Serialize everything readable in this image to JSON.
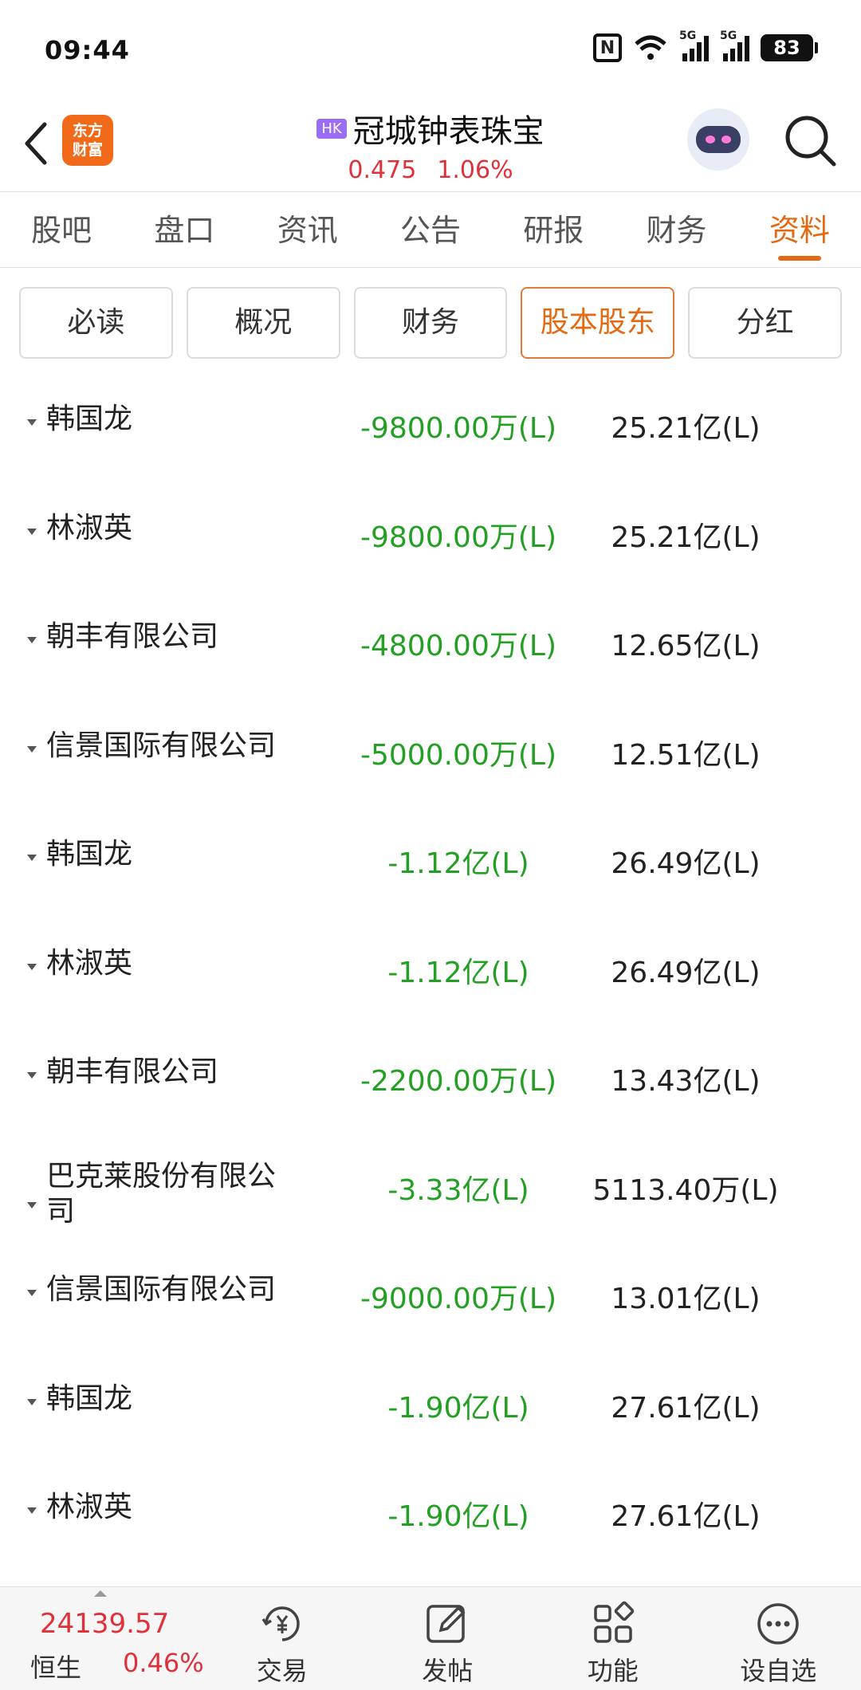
{
  "status_bar": {
    "time": "09:44",
    "signal1": "5G",
    "signal2": "5G",
    "battery": "83",
    "nfc": "N"
  },
  "header": {
    "logo_line1": "东方",
    "logo_line2": "财富",
    "market_badge": "HK",
    "stock_name": "冠城钟表珠宝",
    "price": "0.475",
    "change_pct": "1.06%"
  },
  "tabs": [
    {
      "label": "股吧",
      "active": false
    },
    {
      "label": "盘口",
      "active": false
    },
    {
      "label": "资讯",
      "active": false
    },
    {
      "label": "公告",
      "active": false
    },
    {
      "label": "研报",
      "active": false
    },
    {
      "label": "财务",
      "active": false
    },
    {
      "label": "资料",
      "active": true
    }
  ],
  "chips": [
    {
      "label": "必读",
      "active": false
    },
    {
      "label": "概况",
      "active": false
    },
    {
      "label": "财务",
      "active": false
    },
    {
      "label": "股本股东",
      "active": true
    },
    {
      "label": "分红",
      "active": false
    }
  ],
  "shareholder_changes": [
    {
      "name": "韩国龙",
      "change": "-9800.00万(L)",
      "holding": "25.21亿(L)"
    },
    {
      "name": "林淑英",
      "change": "-9800.00万(L)",
      "holding": "25.21亿(L)"
    },
    {
      "name": "朝丰有限公司",
      "change": "-4800.00万(L)",
      "holding": "12.65亿(L)"
    },
    {
      "name": "信景国际有限公司",
      "change": "-5000.00万(L)",
      "holding": "12.51亿(L)"
    },
    {
      "name": "韩国龙",
      "change": "-1.12亿(L)",
      "holding": "26.49亿(L)"
    },
    {
      "name": "林淑英",
      "change": "-1.12亿(L)",
      "holding": "26.49亿(L)"
    },
    {
      "name": "朝丰有限公司",
      "change": "-2200.00万(L)",
      "holding": "13.43亿(L)"
    },
    {
      "name": "巴克莱股份有限公司",
      "change": "-3.33亿(L)",
      "holding": "5113.40万(L)"
    },
    {
      "name": "信景国际有限公司",
      "change": "-9000.00万(L)",
      "holding": "13.01亿(L)"
    },
    {
      "name": "韩国龙",
      "change": "-1.90亿(L)",
      "holding": "27.61亿(L)"
    },
    {
      "name": "林淑英",
      "change": "-1.90亿(L)",
      "holding": "27.61亿(L)"
    }
  ],
  "bottom_bar": {
    "index_value": "24139.57",
    "index_name": "恒生",
    "index_change": "0.46%",
    "nav": [
      {
        "label": "交易",
        "icon": "trade-yen-icon"
      },
      {
        "label": "发帖",
        "icon": "compose-icon"
      },
      {
        "label": "功能",
        "icon": "apps-grid-icon"
      },
      {
        "label": "设自选",
        "icon": "more-circle-icon"
      }
    ]
  },
  "colors": {
    "accent": "#e36a12",
    "up_red": "#e0313b",
    "down_green": "#23a024",
    "hk_badge": "#9b6cf5"
  }
}
